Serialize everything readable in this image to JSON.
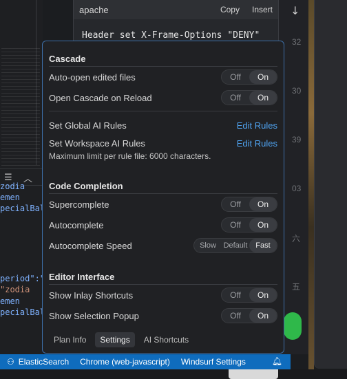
{
  "background": {
    "gutter_numbers": [
      "32",
      "30",
      "39",
      "03",
      "六",
      "五"
    ],
    "code_lines": [
      {
        "text": "zodia",
        "cls": "code-blue"
      },
      {
        "text": "emen",
        "cls": "code-blue"
      },
      {
        "text": "pecialBal",
        "cls": "code-blue"
      },
      {
        "text": "period\":\"",
        "cls": "code-blue"
      },
      {
        "text": "\"zodia",
        "cls": "code-orange"
      },
      {
        "text": "emen",
        "cls": "code-blue"
      },
      {
        "text": "pecialBal",
        "cls": "code-blue"
      }
    ]
  },
  "snippet": {
    "language": "apache",
    "copy_label": "Copy",
    "insert_label": "Insert",
    "code": "Header set X-Frame-Options \"DENY\""
  },
  "popup": {
    "cascade": {
      "title": "Cascade",
      "auto_open": {
        "label": "Auto-open edited files",
        "off": "Off",
        "on": "On",
        "value": "On"
      },
      "open_on_reload": {
        "label": "Open Cascade on Reload",
        "off": "Off",
        "on": "On",
        "value": "On"
      },
      "global_rules": {
        "label": "Set Global AI Rules",
        "action": "Edit Rules"
      },
      "workspace_rules": {
        "label": "Set Workspace AI Rules",
        "action": "Edit Rules"
      },
      "limit_note": "Maximum limit per rule file: 6000 characters."
    },
    "code_completion": {
      "title": "Code Completion",
      "supercomplete": {
        "label": "Supercomplete",
        "off": "Off",
        "on": "On",
        "value": "On"
      },
      "autocomplete": {
        "label": "Autocomplete",
        "off": "Off",
        "on": "On",
        "value": "On"
      },
      "speed": {
        "label": "Autocomplete Speed",
        "options": [
          "Slow",
          "Default",
          "Fast"
        ],
        "value": "Fast"
      }
    },
    "editor_interface": {
      "title": "Editor Interface",
      "inlay": {
        "label": "Show Inlay Shortcuts",
        "off": "Off",
        "on": "On",
        "value": "On"
      },
      "selection_popup": {
        "label": "Show Selection Popup",
        "off": "Off",
        "on": "On",
        "value": "On"
      }
    },
    "tabs": [
      "Plan Info",
      "Settings",
      "AI Shortcuts"
    ],
    "active_tab": "Settings"
  },
  "statusbar": {
    "elastic": "ElasticSearch",
    "chrome": "Chrome (web-javascript)",
    "windsurf": "Windsurf Settings"
  },
  "colors": {
    "accent": "#0f6cbd",
    "link": "#4fa3f0",
    "popup_border": "#3c6fa8"
  }
}
